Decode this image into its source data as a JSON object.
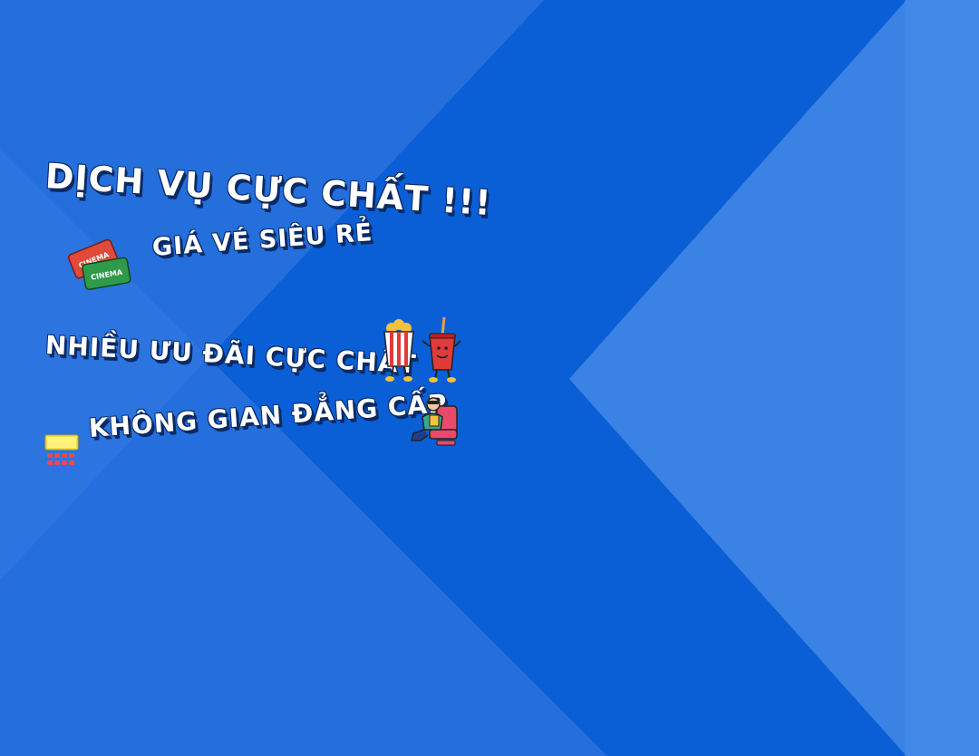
{
  "title": "DỊCH VỤ CỰC CHẤT !!!",
  "features": [
    {
      "text": "GIÁ VÉ SIÊU RẺ",
      "icon": "cinema-ticket-icon"
    },
    {
      "text": "NHIỀU ƯU ĐÃI CỰC CHẤT",
      "icon": "popcorn-soda-icon"
    },
    {
      "text": "KHÔNG GIAN ĐẲNG CẤP",
      "icons": [
        "theater-seats-icon",
        "moviegoer-icon"
      ]
    }
  ],
  "ticket_label": "CINEMA",
  "colors": {
    "background": "#0a5fd6",
    "light_triangle": "#2f76e0",
    "outline": "#0a2a66",
    "text": "#ffffff"
  }
}
